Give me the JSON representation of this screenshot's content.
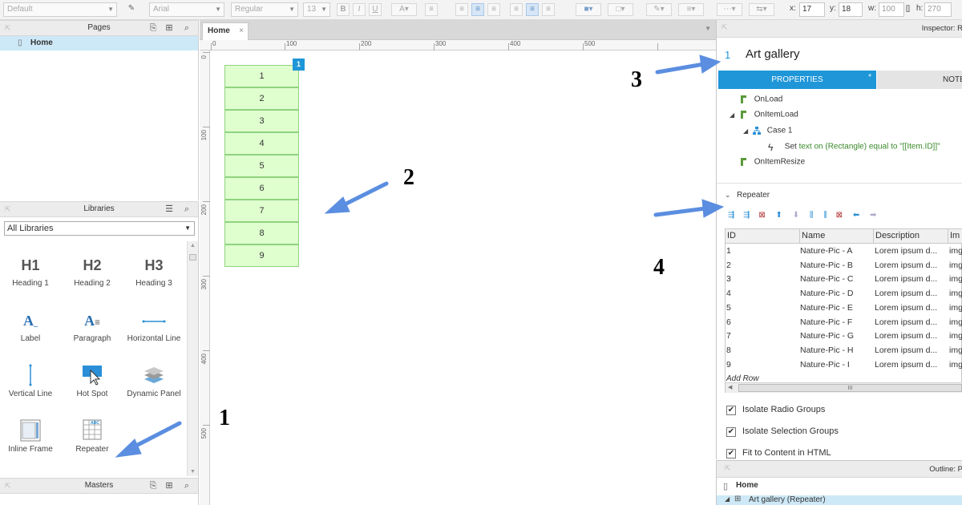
{
  "toolbar": {
    "style": "Default",
    "font": "Arial",
    "weight": "Regular",
    "size": "13",
    "bold": "B",
    "italic": "I",
    "underline": "U",
    "x_label": "x:",
    "x_value": "17",
    "y_label": "y:",
    "y_value": "18",
    "w_label": "w:",
    "w_value": "100",
    "h_label": "h:",
    "h_value": "270",
    "inspector_title": "Inspector: R"
  },
  "pages": {
    "title": "Pages",
    "items": [
      "Home"
    ]
  },
  "libraries": {
    "title": "Libraries",
    "selected": "All Libraries",
    "items": [
      {
        "glyph": "H1",
        "label": "Heading 1"
      },
      {
        "glyph": "H2",
        "label": "Heading 2"
      },
      {
        "glyph": "H3",
        "label": "Heading 3"
      },
      {
        "glyph": "A",
        "label": "Label"
      },
      {
        "glyph": "A",
        "label": "Paragraph"
      },
      {
        "glyph": "",
        "label": "Horizontal Line"
      },
      {
        "glyph": "",
        "label": "Vertical Line"
      },
      {
        "glyph": "",
        "label": "Hot Spot"
      },
      {
        "glyph": "",
        "label": "Dynamic Panel"
      },
      {
        "glyph": "",
        "label": "Inline Frame"
      },
      {
        "glyph": "",
        "label": "Repeater"
      }
    ]
  },
  "masters": {
    "title": "Masters"
  },
  "canvas": {
    "tab": "Home",
    "tab_close": "×",
    "ruler_h": [
      "100",
      "200",
      "300",
      "400",
      "500"
    ],
    "ruler_v": [
      "100",
      "200",
      "300",
      "400",
      "500"
    ],
    "ruler_zero_h": "0",
    "ruler_zero_v": "0",
    "badge": "1",
    "repeater_items": [
      "1",
      "2",
      "3",
      "4",
      "5",
      "6",
      "7",
      "8",
      "9"
    ]
  },
  "annotations": [
    "1",
    "2",
    "3",
    "4"
  ],
  "inspector": {
    "number": "1",
    "widget_name": "Art gallery",
    "tab_properties": "PROPERTIES",
    "tab_marker": "*",
    "tab_notes": "NOTE",
    "events": {
      "onload": "OnLoad",
      "onitemload": "OnItemLoad",
      "case1": "Case 1",
      "action_prefix": "Set",
      "action_text": "text on (Rectangle) equal to \"[[Item.ID]]\"",
      "onitemresize": "OnItemResize"
    },
    "repeater_section": "Repeater",
    "columns": [
      "ID",
      "Name",
      "Description",
      "Im"
    ],
    "rows": [
      {
        "id": "1",
        "name": "Nature-Pic - A",
        "desc": "Lorem ipsum d...",
        "img": "img"
      },
      {
        "id": "2",
        "name": "Nature-Pic - B",
        "desc": "Lorem ipsum d...",
        "img": "img"
      },
      {
        "id": "3",
        "name": "Nature-Pic - C",
        "desc": "Lorem ipsum d...",
        "img": "img"
      },
      {
        "id": "4",
        "name": "Nature-Pic - D",
        "desc": "Lorem ipsum d...",
        "img": "img"
      },
      {
        "id": "5",
        "name": "Nature-Pic - E",
        "desc": "Lorem ipsum d...",
        "img": "img"
      },
      {
        "id": "6",
        "name": "Nature-Pic - F",
        "desc": "Lorem ipsum d...",
        "img": "img"
      },
      {
        "id": "7",
        "name": "Nature-Pic - G",
        "desc": "Lorem ipsum d...",
        "img": "img"
      },
      {
        "id": "8",
        "name": "Nature-Pic - H",
        "desc": "Lorem ipsum d...",
        "img": "img"
      },
      {
        "id": "9",
        "name": "Nature-Pic - I",
        "desc": "Lorem ipsum d...",
        "img": "img"
      }
    ],
    "add_row": "Add Row",
    "scroll_grip": "III",
    "options": [
      {
        "label": "Isolate Radio Groups",
        "checked": true
      },
      {
        "label": "Isolate Selection Groups",
        "checked": true
      },
      {
        "label": "Fit to Content in HTML",
        "checked": true
      }
    ]
  },
  "outline": {
    "title": "Outline: P",
    "page": "Home",
    "item": "Art gallery (Repeater)"
  },
  "colors": {
    "accent": "#1e96d8",
    "tab_active": "#1e96d8",
    "repeater_fill": "#dfffcf",
    "repeater_border": "#8fd37e",
    "arrow": "#5b8ee0",
    "selection": "#cde8f6"
  }
}
